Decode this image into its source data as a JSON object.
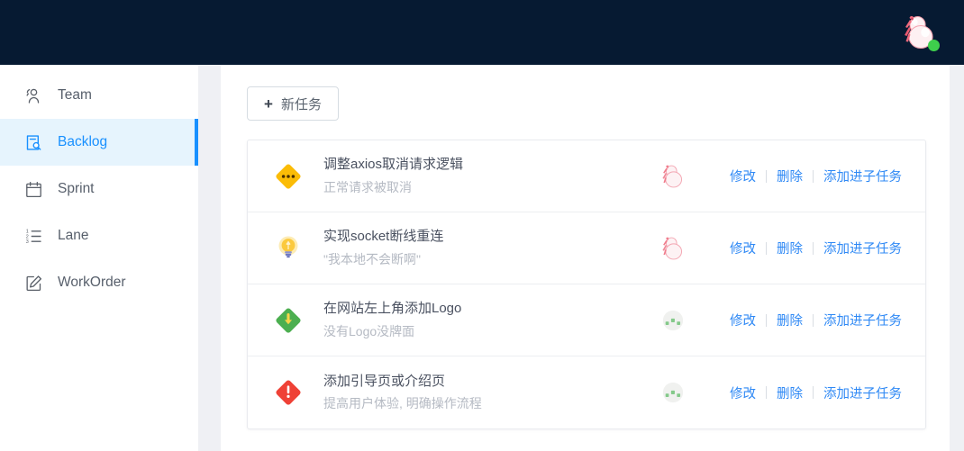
{
  "header": {
    "avatar_name": "user-avatar",
    "status": "online",
    "status_color": "#3ecf4c",
    "background_color": "#061a32"
  },
  "sidebar": {
    "items": [
      {
        "id": "team",
        "label": "Team",
        "icon": "team-icon",
        "active": false
      },
      {
        "id": "backlog",
        "label": "Backlog",
        "icon": "backlog-icon",
        "active": true
      },
      {
        "id": "sprint",
        "label": "Sprint",
        "icon": "calendar-icon",
        "active": false
      },
      {
        "id": "lane",
        "label": "Lane",
        "icon": "ordered-list-icon",
        "active": false
      },
      {
        "id": "workorder",
        "label": "WorkOrder",
        "icon": "edit-square-icon",
        "active": false
      }
    ],
    "active_color": "#1890ff",
    "active_background": "#e6f4fd"
  },
  "toolbar": {
    "new_task_label": "新任务",
    "new_task_plus": "+"
  },
  "task_list": {
    "rows": [
      {
        "priority_icon": "priority-medium-dots-icon",
        "priority_color": "#fbbc06",
        "title": "调整axios取消请求逻辑",
        "subtitle": "正常请求被取消",
        "assignee_icon": "avatar-pink-icon",
        "actions": [
          "修改",
          "删除",
          "添加进子任务"
        ]
      },
      {
        "priority_icon": "priority-idea-bulb-icon",
        "priority_color": "#fbd247",
        "title": "实现socket断线重连",
        "subtitle": "\"我本地不会断啊\"",
        "assignee_icon": "avatar-pink-icon",
        "actions": [
          "修改",
          "删除",
          "添加进子任务"
        ]
      },
      {
        "priority_icon": "priority-low-arrow-down-icon",
        "priority_color": "#4caf50",
        "title": "在网站左上角添加Logo",
        "subtitle": "没有Logo没牌面",
        "assignee_icon": "avatar-green-icon",
        "actions": [
          "修改",
          "删除",
          "添加进子任务"
        ]
      },
      {
        "priority_icon": "priority-high-exclamation-icon",
        "priority_color": "#ef4136",
        "title": "添加引导页或介绍页",
        "subtitle": "提高用户体验, 明确操作流程",
        "assignee_icon": "avatar-green-icon",
        "actions": [
          "修改",
          "删除",
          "添加进子任务"
        ]
      }
    ]
  },
  "theme": {
    "link_color": "#2f89f5",
    "title_color": "#4a5160",
    "subtitle_color": "#b5bac3",
    "gutter_color": "#eff0f4"
  }
}
